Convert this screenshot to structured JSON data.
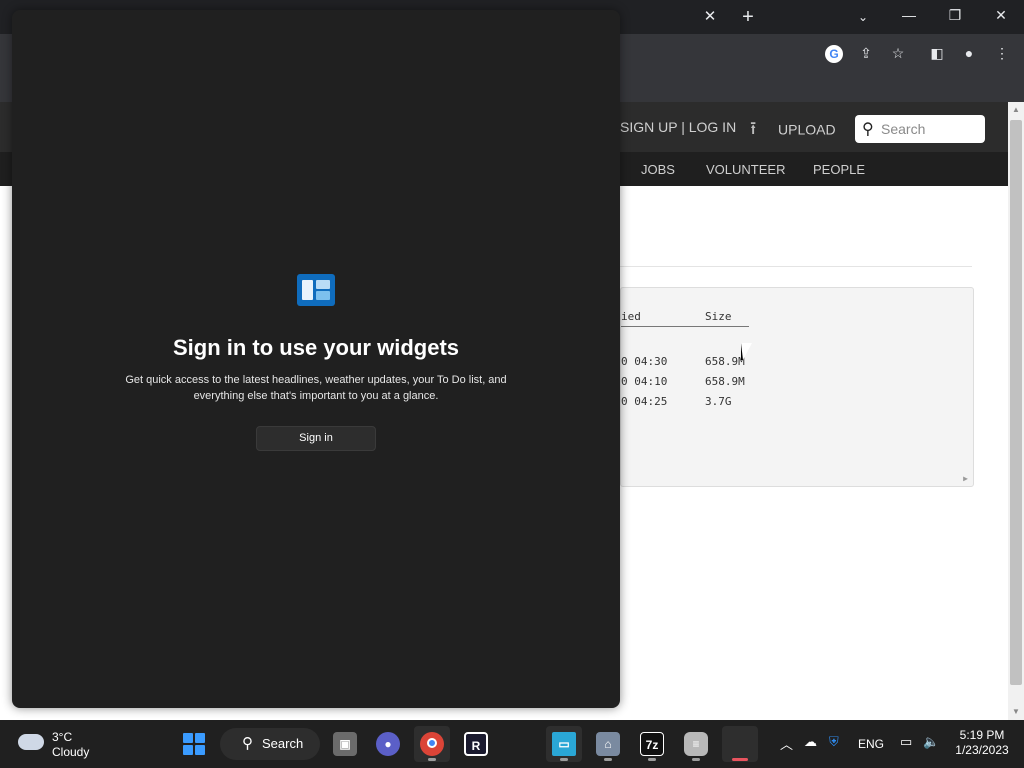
{
  "browser": {
    "tab_close_glyph": "✕",
    "new_tab_glyph": "+",
    "tab_search_glyph": "⌄",
    "window_controls": {
      "minimize": "—",
      "restore": "❐",
      "close": "✕"
    },
    "toolbar_icons": [
      "google-icon",
      "share-icon",
      "bookmark-star-icon",
      "side-panel-icon",
      "profile-icon",
      "menu-icon"
    ]
  },
  "site": {
    "auth_links": "SIGN UP | LOG IN",
    "upload_label": "UPLOAD",
    "search_placeholder": "Search",
    "nav": [
      "JOBS",
      "VOLUNTEER",
      "PEOPLE"
    ],
    "listing": {
      "columns": [
        "ied",
        "Size"
      ],
      "rows": [
        {
          "modified": "0 04:30",
          "size": "658.9M"
        },
        {
          "modified": "0 04:10",
          "size": "658.9M"
        },
        {
          "modified": "0 04:25",
          "size": "3.7G"
        }
      ]
    }
  },
  "widgets": {
    "title": "Sign in to use your widgets",
    "description": "Get quick access to the latest headlines, weather updates, your To Do list, and everything else that's important to you at a glance.",
    "signin_label": "Sign in"
  },
  "taskbar": {
    "weather": {
      "temp": "3°C",
      "condition": "Cloudy"
    },
    "search_label": "Search",
    "language": "ENG",
    "time": "5:19 PM",
    "date": "1/23/2023"
  },
  "colors": {
    "accent": "#0f6cbd",
    "widget_panel_bg": "#202020",
    "browser_chrome": "#202124",
    "site_header": "#2c2c2c"
  }
}
